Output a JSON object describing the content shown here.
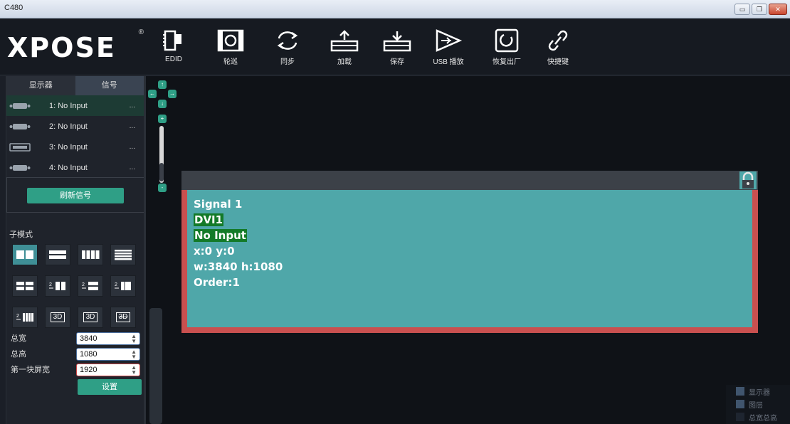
{
  "window": {
    "title": "C480"
  },
  "logo": {
    "text": "XPOSE",
    "reg": "®"
  },
  "toolbar": [
    {
      "label": "EDID",
      "icon": "edid-icon"
    },
    {
      "label": "轮巡",
      "icon": "polling-icon"
    },
    {
      "label": "同步",
      "icon": "sync-icon"
    },
    {
      "label": "加载",
      "icon": "load-icon"
    },
    {
      "label": "保存",
      "icon": "save-icon"
    },
    {
      "label": "USB 播放",
      "icon": "usb-play-icon"
    },
    {
      "label": "恢复出厂",
      "icon": "factory-reset-icon"
    },
    {
      "label": "快捷键",
      "icon": "shortcut-link-icon"
    }
  ],
  "tabs": [
    {
      "label": "显示器",
      "active": false
    },
    {
      "label": "信号",
      "active": true
    }
  ],
  "signals": [
    {
      "label": "1: No Input",
      "type": "DVI",
      "more": "..."
    },
    {
      "label": "2: No Input",
      "type": "DVI",
      "more": "..."
    },
    {
      "label": "3: No Input",
      "type": "HDMI",
      "more": "..."
    },
    {
      "label": "4: No Input",
      "type": "DVI",
      "more": "..."
    }
  ],
  "refresh_label": "刷新信号",
  "submode_label": "子模式",
  "mode_3d_labels": [
    "3D",
    "3D",
    "3D"
  ],
  "fields": {
    "total_width_label": "总宽",
    "total_width_value": "3840",
    "total_height_label": "总高",
    "total_height_value": "1080",
    "first_screen_width_label": "第一块屏宽",
    "first_screen_width_value": "1920"
  },
  "set_label": "设置",
  "nav": {
    "up": "↑",
    "down": "↓",
    "left": "←",
    "right": "→",
    "zoom_in": "+",
    "zoom_out": "-"
  },
  "layer": {
    "signal": "Signal 1",
    "source": "DVI1",
    "status": "No Input",
    "pos": "x:0  y:0",
    "size": "w:3840  h:1080",
    "order": "Order:1"
  },
  "legend": [
    "显示器",
    "图层",
    "总宽总高"
  ],
  "colors": {
    "accent": "#2f9f86",
    "layer_fill": "#4fa7a9",
    "layer_border": "#c9504f",
    "highlight": "#137a28"
  }
}
